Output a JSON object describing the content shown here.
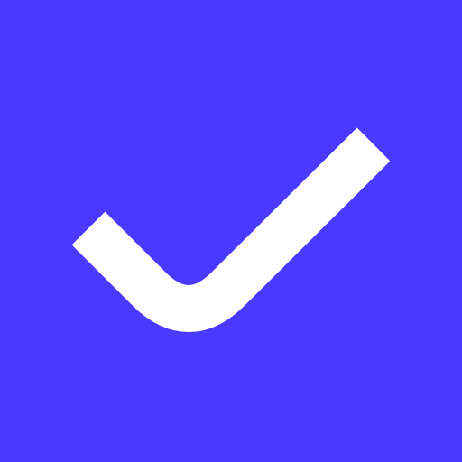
{
  "icon": {
    "name": "checkmark-icon",
    "background_color": "#4a3aff",
    "mark_color": "#ffffff"
  }
}
